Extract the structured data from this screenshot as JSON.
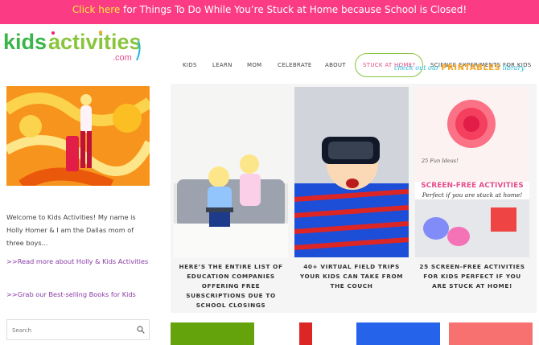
{
  "banner": {
    "link_text": "Click here",
    "text": " for Things To Do While You’re Stuck at Home because School is Closed!"
  },
  "logo": {
    "alt": "kids activities .com"
  },
  "nav": {
    "items": [
      "Kids",
      "Learn",
      "Mom",
      "Celebrate",
      "About",
      "Stuck at Home?",
      "Science Experiments for Kids"
    ]
  },
  "printables": {
    "part1": "check out our ",
    "part2": "PRINTABLES",
    "part3": " library"
  },
  "sidebar": {
    "intro": "Welcome to Kids Activities! My name is Holly Homer & I am the Dallas mom of three boys...",
    "link_about": ">>Read more about Holly & Kids Activities",
    "link_books": ">>Grab our Best-selling Books for Kids",
    "search_placeholder": "Search"
  },
  "cards": [
    {
      "title": "Here’s the Entire List of Education Companies Offering Free Subscriptions Due to School Closings"
    },
    {
      "title": "40+ Virtual Field Trips Your Kids Can Take From The Couch"
    },
    {
      "title": "25 Screen-Free Activities for Kids Perfect if You Are Stuck at Home!"
    }
  ],
  "card3_overlay": {
    "fun_ideas": "25 Fun Ideas!",
    "heading": "SCREEN-FREE ACTIVITIES",
    "subheading": "Perfect if you are stuck at home!"
  },
  "colors": {
    "banner_bg": "#fb3c84",
    "banner_link": "#ffee3c",
    "accent_green": "#8ac43f",
    "accent_pink": "#e54d8a",
    "link_purple": "#8b3ca6"
  }
}
